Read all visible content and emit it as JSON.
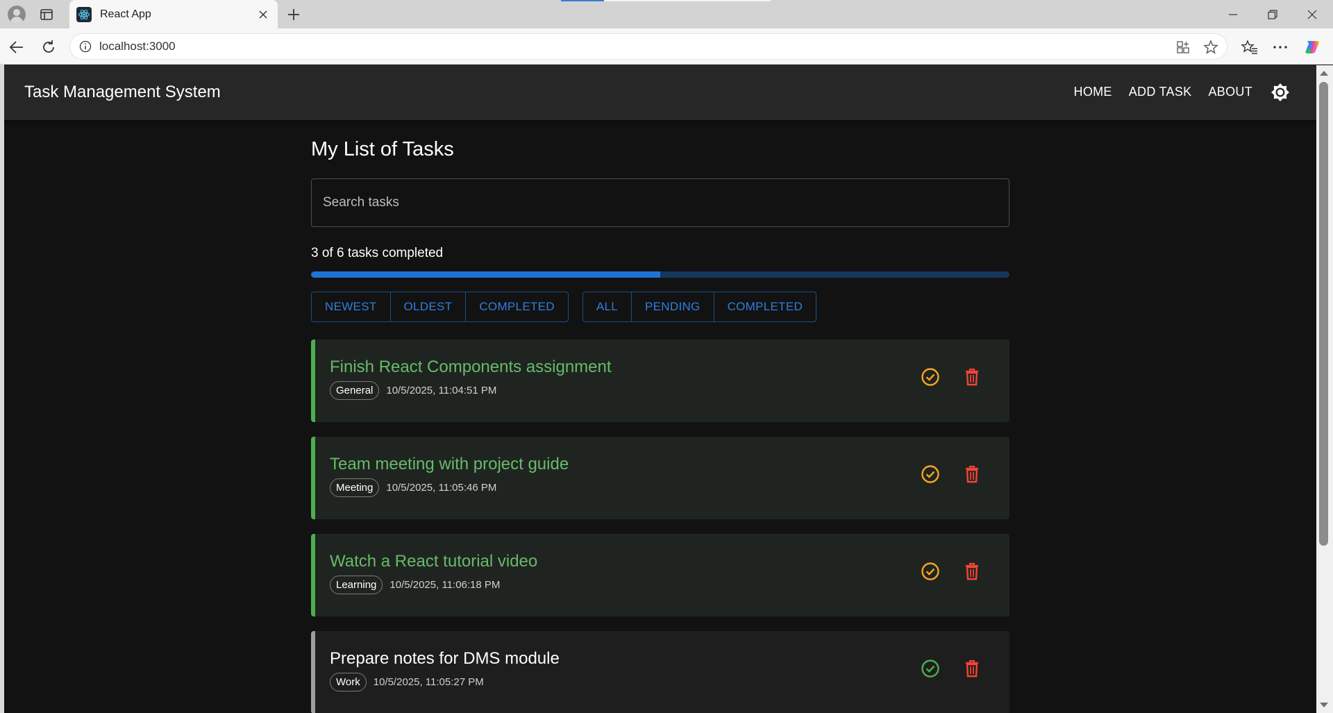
{
  "browser": {
    "tab_title": "React App",
    "url": "localhost:3000"
  },
  "app": {
    "title": "Task Management System",
    "nav": [
      "HOME",
      "ADD TASK",
      "ABOUT"
    ]
  },
  "main": {
    "page_title": "My List of Tasks",
    "search_placeholder": "Search tasks",
    "progress_text": "3 of 6 tasks completed",
    "progress_fraction": 0.5,
    "sort_buttons": [
      "NEWEST",
      "OLDEST",
      "COMPLETED"
    ],
    "filter_buttons": [
      "ALL",
      "PENDING",
      "COMPLETED"
    ]
  },
  "tasks": [
    {
      "title": "Finish React Components assignment",
      "category": "General",
      "date": "10/5/2025, 11:04:51 PM",
      "completed": true
    },
    {
      "title": "Team meeting with project guide",
      "category": "Meeting",
      "date": "10/5/2025, 11:05:46 PM",
      "completed": true
    },
    {
      "title": "Watch a React tutorial video",
      "category": "Learning",
      "date": "10/5/2025, 11:06:18 PM",
      "completed": true
    },
    {
      "title": "Prepare notes for DMS module",
      "category": "Work",
      "date": "10/5/2025, 11:05:27 PM",
      "completed": false
    }
  ],
  "colors": {
    "accent": "#1e74d2",
    "completed_title": "#66bb6a",
    "undo_icon": "#f5a623",
    "complete_icon": "#4caf50",
    "delete_icon": "#f44336"
  },
  "icons": {
    "profile": "profile-icon",
    "theme_toggle": "sun-icon",
    "undo_complete": "check-circle-outline-icon",
    "delete": "trash-icon"
  }
}
